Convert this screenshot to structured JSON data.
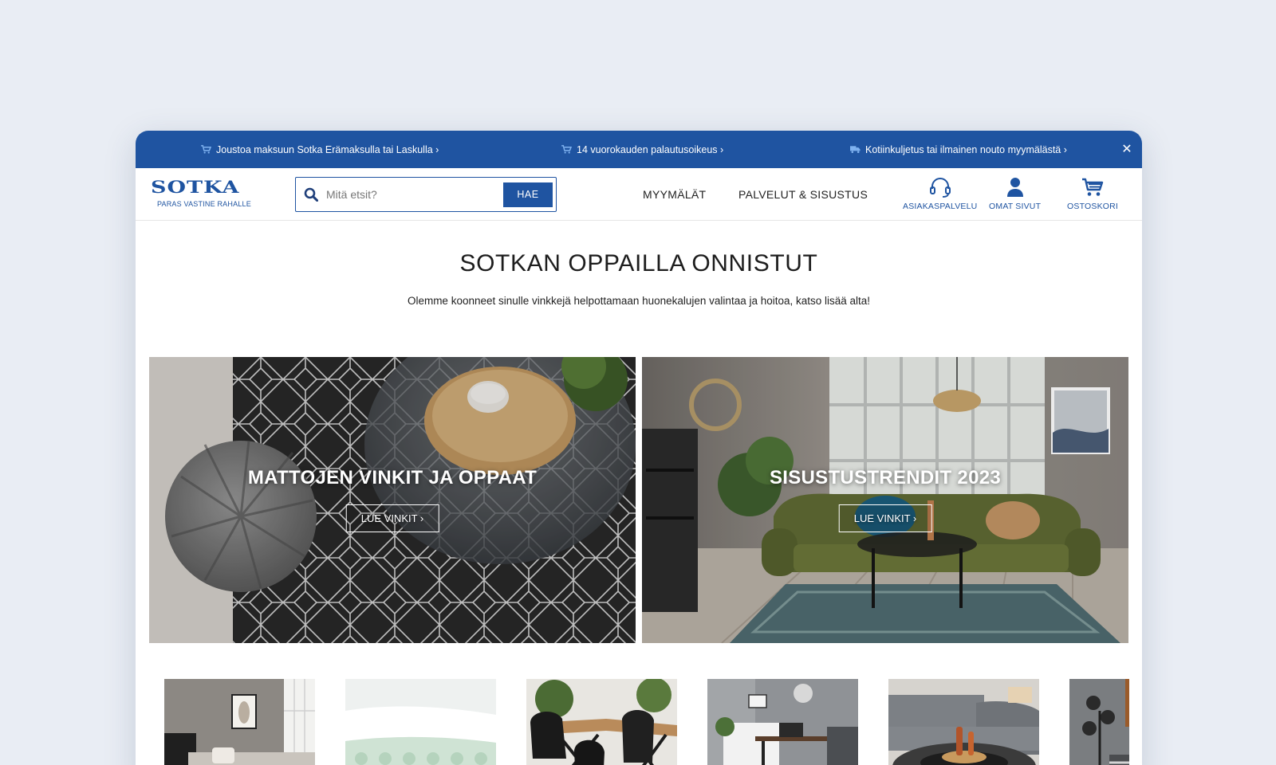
{
  "promo_bar": {
    "items": [
      {
        "icon": "cart-icon",
        "text": "Joustoa maksuun Sotka Erämaksulla tai Laskulla ›"
      },
      {
        "icon": "cart-icon",
        "text": "14 vuorokauden palautusoikeus ›"
      },
      {
        "icon": "truck-icon",
        "text": "Kotiinkuljetus tai ilmainen nouto myymälästä ›"
      }
    ],
    "close_icon": "close-icon"
  },
  "header": {
    "logo_text": "SOTKA",
    "logo_tagline": "PARAS VASTINE RAHALLE",
    "search": {
      "placeholder": "Mitä etsit?",
      "value": "",
      "button_label": "HAE"
    },
    "nav": [
      {
        "label": "MYYMÄLÄT"
      },
      {
        "label": "PALVELUT & SISUSTUS"
      }
    ],
    "utilities": [
      {
        "icon": "headset-icon",
        "label": "ASIAKASPALVELU"
      },
      {
        "icon": "user-icon",
        "label": "OMAT SIVUT"
      },
      {
        "icon": "cart-icon",
        "label": "OSTOSKORI"
      }
    ]
  },
  "main": {
    "title": "SOTKAN OPPAILLA ONNISTUT",
    "subtitle": "Olemme koonneet sinulle vinkkejä helpottamaan huonekalujen valintaa ja hoitoa, katso lisää alta!",
    "banners": [
      {
        "title": "MATTOJEN VINKIT JA OPPAAT",
        "button_label": "LUE VINKIT ›"
      },
      {
        "title": "SISUSTUSTRENDIT 2023",
        "button_label": "LUE VINKIT ›"
      }
    ]
  },
  "colors": {
    "brand_blue": "#1f54a1",
    "page_bg": "#e9edf4"
  }
}
